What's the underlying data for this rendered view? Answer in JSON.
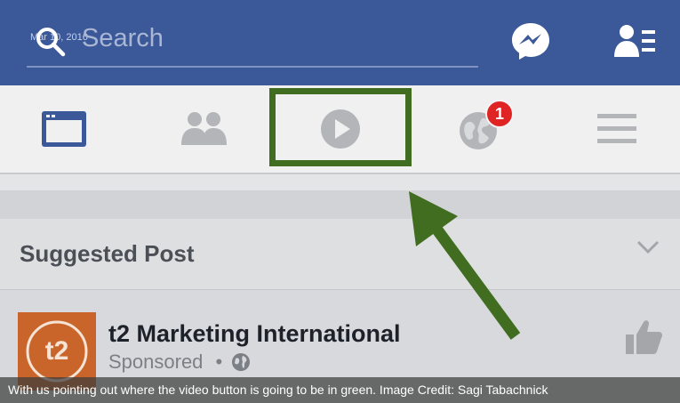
{
  "search": {
    "placeholder": "Search",
    "date_stamp": "Mar 10, 2016"
  },
  "nav": {
    "tabs": [
      {
        "name": "news-feed",
        "icon": "news-feed-icon"
      },
      {
        "name": "friends",
        "icon": "friends-icon"
      },
      {
        "name": "video",
        "icon": "play-icon"
      },
      {
        "name": "notifications",
        "icon": "globe-icon"
      },
      {
        "name": "menu",
        "icon": "hamburger-icon"
      }
    ],
    "notification_count": "1"
  },
  "feed": {
    "section_title": "Suggested Post",
    "post": {
      "page_name": "t2 Marketing International",
      "logo_text": "t2",
      "sponsored_label": "Sponsored",
      "separator": "•"
    }
  },
  "caption": "With us pointing out where the video button is going to be in green. Image Credit: Sagi Tabachnick",
  "colors": {
    "brand": "#3b5998",
    "highlight": "#416d21",
    "badge": "#e02323",
    "logo": "#c9652a"
  }
}
